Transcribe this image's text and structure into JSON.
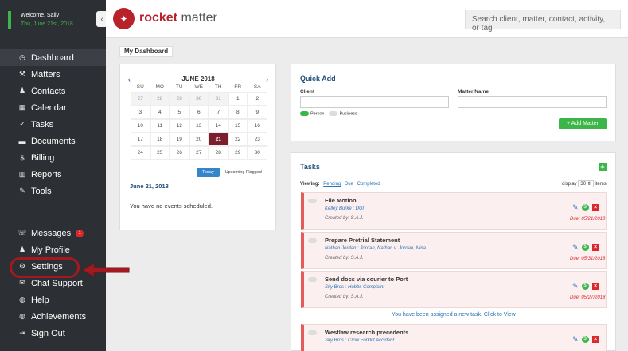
{
  "sidebar": {
    "welcome": "Welcome, Sally",
    "date": "Thu, June 21st, 2018",
    "collapse_icon": "chevron-left-icon",
    "nav": [
      {
        "label": "Dashboard",
        "icon": "◷",
        "active": true
      },
      {
        "label": "Matters",
        "icon": "⚒",
        "active": false
      },
      {
        "label": "Contacts",
        "icon": "♟",
        "active": false
      },
      {
        "label": "Calendar",
        "icon": "▦",
        "active": false
      },
      {
        "label": "Tasks",
        "icon": "✓",
        "active": false
      },
      {
        "label": "Documents",
        "icon": "▬",
        "active": false
      },
      {
        "label": "Billing",
        "icon": "$",
        "active": false
      },
      {
        "label": "Reports",
        "icon": "▥",
        "active": false
      },
      {
        "label": "Tools",
        "icon": "✎",
        "active": false
      }
    ],
    "nav2": [
      {
        "label": "Messages",
        "icon": "☏",
        "badge": "1"
      },
      {
        "label": "My Profile",
        "icon": "♟",
        "badge": ""
      },
      {
        "label": "Settings",
        "icon": "⚙",
        "badge": ""
      },
      {
        "label": "Chat Support",
        "icon": "✉",
        "badge": ""
      },
      {
        "label": "Help",
        "icon": "◍",
        "badge": ""
      },
      {
        "label": "Achievements",
        "icon": "◍",
        "badge": ""
      },
      {
        "label": "Sign Out",
        "icon": "⇥",
        "badge": ""
      }
    ]
  },
  "header": {
    "logo_bold": "rocket",
    "logo_light": " matter",
    "search_placeholder": "Search client, matter, contact, activity, or tag"
  },
  "dashboard_tab": "My Dashboard",
  "calendar": {
    "month": "JUNE 2018",
    "dow": [
      "SU",
      "MO",
      "TU",
      "WE",
      "TH",
      "FR",
      "SA"
    ],
    "weeks": [
      [
        "27",
        "28",
        "29",
        "30",
        "31",
        "1",
        "2"
      ],
      [
        "3",
        "4",
        "5",
        "6",
        "7",
        "8",
        "9"
      ],
      [
        "10",
        "11",
        "12",
        "13",
        "14",
        "15",
        "16"
      ],
      [
        "17",
        "18",
        "19",
        "20",
        "21",
        "22",
        "23"
      ],
      [
        "24",
        "25",
        "26",
        "27",
        "28",
        "29",
        "30"
      ]
    ],
    "today_label": "Today",
    "flagged_label": "Upcoming Flagged",
    "selected_date": "June 21, 2018",
    "empty_text": "You have no events scheduled."
  },
  "quick_add": {
    "title": "Quick Add",
    "client_label": "Client",
    "matter_label": "Matter Name",
    "person_label": "Person",
    "business_label": "Business",
    "add_matter_label": "+ Add Matter"
  },
  "tasks": {
    "title": "Tasks",
    "viewing_label": "Viewing:",
    "filters": [
      "Pending",
      "Due",
      "Completed"
    ],
    "display_label": "display",
    "display_count": "30 ⇕",
    "items_label": "items",
    "assigned_notice": "You have been assigned a new task. Click to View",
    "list": [
      {
        "title": "File Motion",
        "sub": "Kelley Burke : DUI",
        "by": "Created by: S.A.J.",
        "due": "Due: 05/21/2018"
      },
      {
        "title": "Prepare Pretrial Statement",
        "sub": "Nathan Jordan : Jordan, Nathan v. Jordan, Nina",
        "by": "Created by: S.A.J.",
        "due": "Due: 05/31/2018"
      },
      {
        "title": "Send docs via courier to Port",
        "sub": "Sky Bros : Hobbs Complaint",
        "by": "Created by: S.A.J.",
        "due": "Due: 05/27/2018"
      },
      {
        "title": "Westlaw research precedents",
        "sub": "Sky Bros : Crow Forklift Accident",
        "by": "",
        "due": ""
      }
    ]
  }
}
